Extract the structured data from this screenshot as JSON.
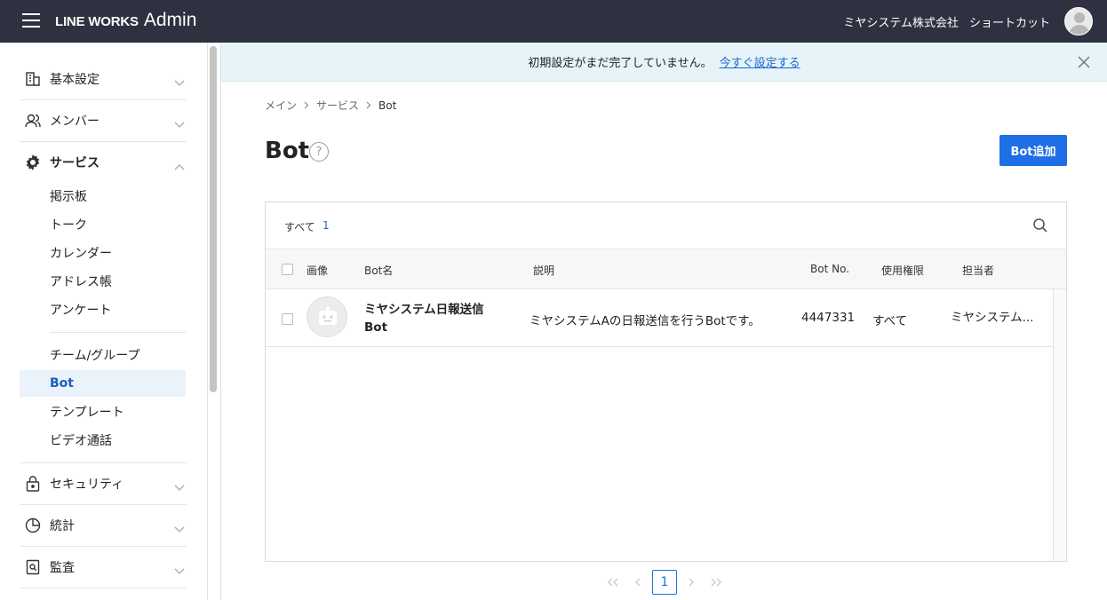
{
  "header": {
    "logo_brand": "LINE WORKS",
    "logo_product": "Admin",
    "company": "ミヤシステム株式会社",
    "shortcut": "ショートカット"
  },
  "sidebar": {
    "sections": [
      {
        "label": "基本設定",
        "icon": "building-icon"
      },
      {
        "label": "メンバー",
        "icon": "members-icon"
      },
      {
        "label": "サービス",
        "icon": "gear-icon"
      },
      {
        "label": "セキュリティ",
        "icon": "lock-icon"
      },
      {
        "label": "統計",
        "icon": "pie-chart-icon"
      },
      {
        "label": "監査",
        "icon": "audit-icon"
      }
    ],
    "service_items": [
      "掲示板",
      "トーク",
      "カレンダー",
      "アドレス帳",
      "アンケート"
    ],
    "service_items2": [
      "チーム/グループ",
      "Bot",
      "テンプレート",
      "ビデオ通話"
    ],
    "active_item": "Bot"
  },
  "banner": {
    "message": "初期設定がまだ完了していません。",
    "link": "今すぐ設定する"
  },
  "breadcrumb": [
    "メイン",
    "サービス",
    "Bot"
  ],
  "page": {
    "title": "Bot",
    "add_button": "Bot追加"
  },
  "list": {
    "count_label": "すべて",
    "count": "1",
    "columns": [
      "画像",
      "Bot名",
      "説明",
      "Bot No.",
      "使用権限",
      "担当者"
    ],
    "rows": [
      {
        "name_line1": "ミヤシステム日報送信",
        "name_line2": "Bot",
        "description": "ミヤシステムAの日報送信を行うBotです。",
        "bot_no": "4447331",
        "permission": "すべて",
        "manager": "ミヤシステム..."
      }
    ]
  },
  "pagination": {
    "current": "1"
  },
  "colors": {
    "header_bg": "#2f3140",
    "accent": "#1e6ee6",
    "banner_bg": "#e6f4fa"
  }
}
